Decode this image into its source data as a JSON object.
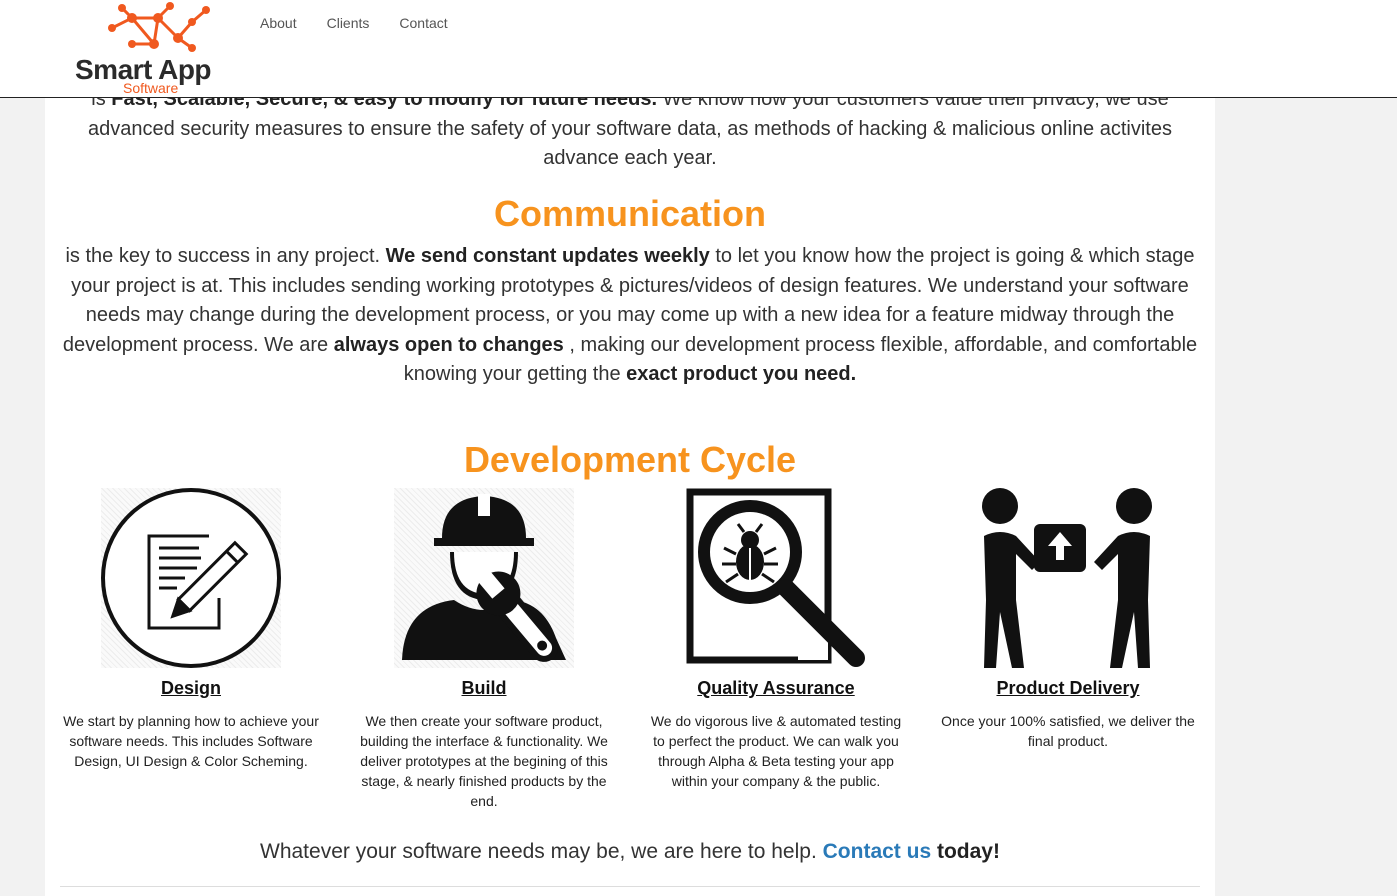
{
  "header": {
    "logo_title": "Smart App",
    "logo_sub": "Software",
    "nav": [
      "About",
      "Clients",
      "Contact"
    ]
  },
  "intro": {
    "lead": "is",
    "bold": "Fast, Scalable, Secure, & easy to modify for future needs.",
    "rest": " We know how your customers value their privacy, we use advanced security measures to ensure the safety of your software data, as methods of hacking & malicious online activites advance each year."
  },
  "communication": {
    "heading": "Communication",
    "t1": "is the key to success in any project. ",
    "b1": "We send constant updates weekly",
    "t2": " to let you know how the project is going & which stage your project is at. This includes sending working prototypes & pictures/videos of design features. We understand your software needs may change during the development process, or you may come up with a new idea for a feature midway through the development process. We are ",
    "b2": "always open to changes",
    "t3": " , making our development process flexible, affordable, and comfortable knowing your getting the ",
    "b3": "exact product you need."
  },
  "cycle": {
    "heading": "Development Cycle",
    "items": [
      {
        "title": "Design",
        "icon": "design-document-pencil-icon",
        "desc": "We start by planning how to achieve your software needs. This includes Software Design, UI Design & Color Scheming."
      },
      {
        "title": "Build",
        "icon": "builder-worker-wrench-icon",
        "desc": "We then create your software product, building the interface & functionality. We deliver prototypes at the begining of this stage, & nearly finished products by the end."
      },
      {
        "title": "Quality Assurance",
        "icon": "bug-magnifier-icon",
        "desc": "We do vigorous live & automated testing to perfect the product. We can walk you through Alpha & Beta testing your app within your company & the public."
      },
      {
        "title": "Product Delivery",
        "icon": "package-handoff-icon",
        "desc": "Once your 100% satisfied, we deliver the final product."
      }
    ]
  },
  "closing": {
    "text": "Whatever your software needs may be, we are here to help. ",
    "link": "Contact us",
    "end": " today!"
  },
  "colors": {
    "accent": "#f7931e",
    "link": "#2a7ab8",
    "logo_orange": "#f0591f"
  }
}
